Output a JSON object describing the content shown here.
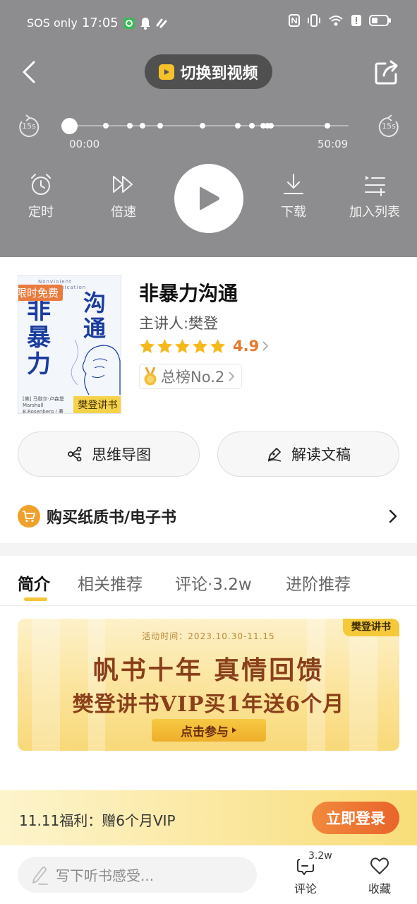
{
  "status_bar": {
    "carrier": "SOS only",
    "time": "17:05"
  },
  "player": {
    "switch_label": "切换到视频",
    "skip_back_label": "15s",
    "skip_forward_label": "15s",
    "elapsed": "00:00",
    "duration": "50:09",
    "progress_fraction": 0.0,
    "controls": {
      "timer": "定时",
      "speed": "倍速",
      "download": "下载",
      "add_to_list": "加入列表"
    }
  },
  "book": {
    "cover": {
      "free_tag": "限时免费",
      "title_left": "非暴力",
      "title_right": "沟通",
      "english": "Nonviolent Communication",
      "author_small": "[美] 马歇尔·卢森堡 Marshall B.Rosenberg / 著",
      "brand": "樊登讲书"
    },
    "title": "非暴力沟通",
    "presenter": "主讲人:樊登",
    "rating": "4.9",
    "stars": 5,
    "rank": "总榜No.2"
  },
  "actions": {
    "mind_map": "思维导图",
    "transcript": "解读文稿"
  },
  "buy": {
    "label": "购买纸质书/电子书"
  },
  "tabs": [
    {
      "label": "简介",
      "active": true
    },
    {
      "label": "相关推荐",
      "active": false
    },
    {
      "label": "评论·3.2w",
      "active": false
    },
    {
      "label": "进阶推荐",
      "active": false
    }
  ],
  "banner": {
    "brand": "樊登讲书",
    "date": "活动时间：2023.10.30-11.15",
    "line1": "帆书十年 真情回馈",
    "line2": "樊登讲书VIP买1年送6个月",
    "cta": "点击参与"
  },
  "promo": {
    "text": "11.11福利：赠6个月VIP",
    "button": "立即登录"
  },
  "bottom": {
    "placeholder": "写下听书感受...",
    "comment_label": "评论",
    "comment_count": "3.2w",
    "favorite_label": "收藏"
  },
  "colors": {
    "player_bg": "#8d8d8f",
    "accent": "#f3c537",
    "rating": "#e8792c",
    "login": "#e9642b"
  }
}
